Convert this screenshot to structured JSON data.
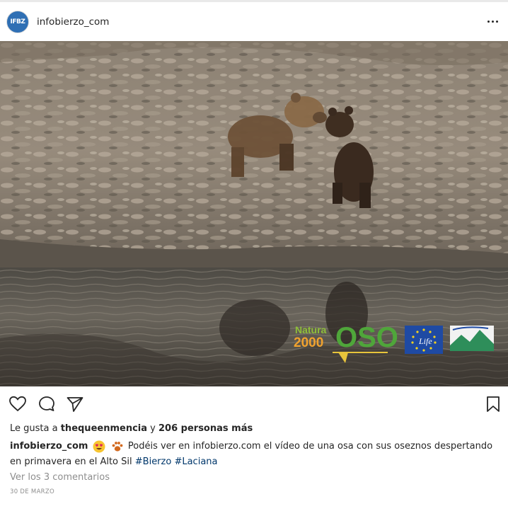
{
  "post": {
    "avatar_text": "IFBZ",
    "username": "infobierzo_com"
  },
  "media": {
    "logo_natura_top": "Natura",
    "logo_natura_bottom": "2000",
    "logo_oso": "OSO",
    "logo_life": "Life"
  },
  "likes": {
    "prefix": "Le gusta a",
    "user": "thequeenmencia",
    "connector": "y",
    "others": "206 personas más"
  },
  "caption": {
    "username": "infobierzo_com",
    "text": "Podéis ver en infobierzo.com el vídeo de una osa con sus oseznos despertando en primavera en el Alto Sil",
    "hashtags": [
      "#Bierzo",
      "#Laciana"
    ]
  },
  "comments_link": "Ver los 3 comentarios",
  "date": "30 DE MARZO",
  "icons": [
    "more-options-icon",
    "heart-icon",
    "comment-icon",
    "share-icon",
    "bookmark-icon",
    "heart-eyes-emoji",
    "paw-emoji"
  ]
}
